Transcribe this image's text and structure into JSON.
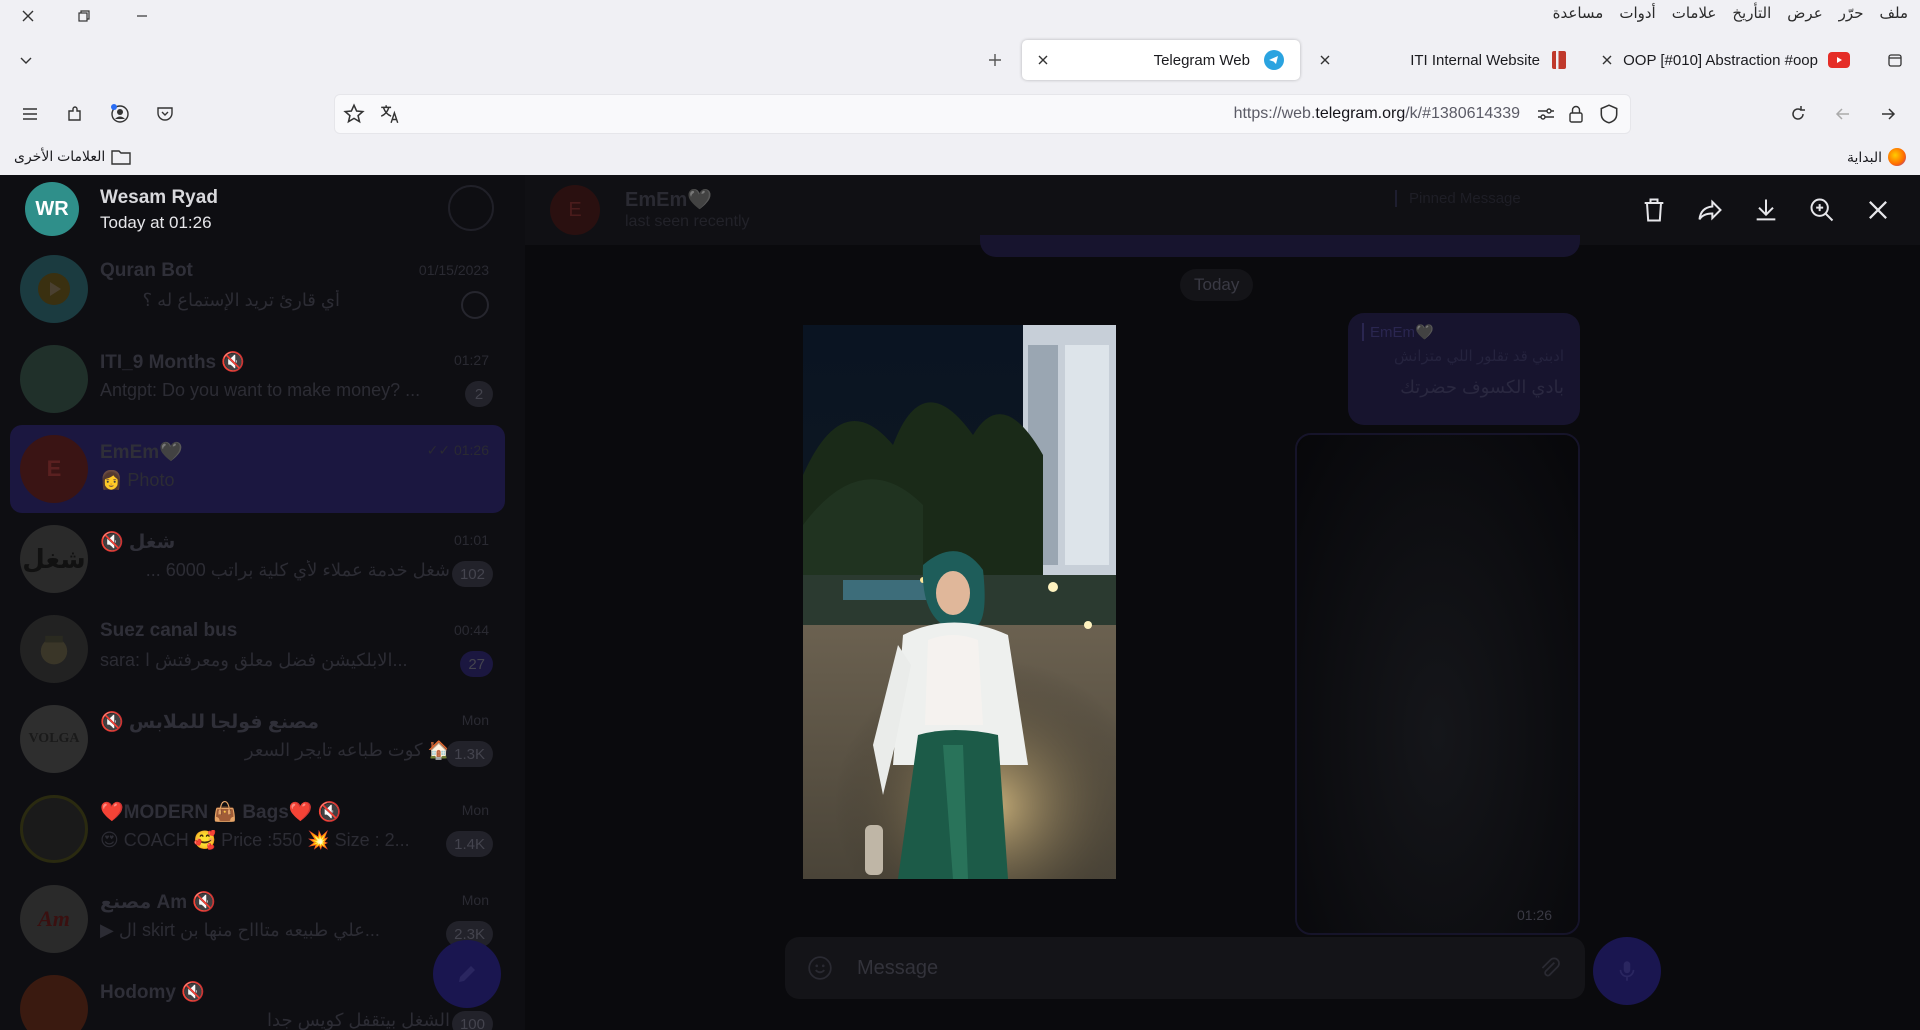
{
  "browser": {
    "menu": [
      "ملف",
      "حرّر",
      "عرض",
      "التأريخ",
      "علامات",
      "أدوات",
      "مساعدة"
    ],
    "tabs": [
      {
        "label": "OOP [#010] Abstraction #oop",
        "icon": "youtube-icon",
        "active": false
      },
      {
        "label": "ITI Internal Website",
        "icon": "iti-logo-icon",
        "active": false
      },
      {
        "label": "Telegram Web",
        "icon": "telegram-icon",
        "active": true
      }
    ],
    "url": {
      "prefix": "https://web.",
      "domain": "telegram.org",
      "suffix": "/k/#1380614339"
    },
    "bookmarks": {
      "home": "البداية",
      "other": "العلامات الأخرى"
    }
  },
  "viewer": {
    "author_initials": "WR",
    "author_name": "Wesam Ryad",
    "date": "Today at 01:26"
  },
  "chat_header": {
    "name": "EmEm🖤",
    "status": "last seen recently",
    "pinned": "Pinned Message"
  },
  "chats": [
    {
      "name": "Quran Bot",
      "preview": "أي قارئ تريد الإستماع له ؟",
      "time": "01/15/2023",
      "badge": "",
      "avatar_color": "#1b3b40"
    },
    {
      "name": "ITI_9 Months 🔇",
      "preview": "Antgpt: Do you want to make money? ...",
      "time": "01:27",
      "badge": "2",
      "avatar_color": "#20302a"
    },
    {
      "name": "EmEm🖤",
      "preview": "👩 Photo",
      "time": "✓✓ 01:26",
      "badge": "",
      "avatar_color": "#3a1414",
      "avatar_letter": "E"
    },
    {
      "name": "شغل 🔇",
      "preview": "شغل خدمة عملاء لأي كلية براتب 6000 ...",
      "time": "01:01",
      "badge": "102",
      "avatar_color": "#2a2a2a",
      "avatar_letter": "شغل"
    },
    {
      "name": "Suez canal bus",
      "preview": "sara: الابلكيشن فضل معلق ومعرفتش ا...",
      "time": "00:44",
      "badge": "27",
      "avatar_color": "#222",
      "avatar_letter": ""
    },
    {
      "name": "مصنع فولجا للملابس 🔇",
      "preview": "🏠 كوت طباعه تايجر السعر",
      "time": "Mon",
      "badge": "1.3K",
      "avatar_color": "#2e2e2e",
      "avatar_letter": "VOLGA"
    },
    {
      "name": "❤️MODERN 👜 Bags❤️ 🔇",
      "preview": "😍 COACH 🥰 Price :550 💥 Size : 2...",
      "time": "Mon",
      "badge": "1.4K",
      "avatar_color": "#1a1a1a",
      "avatar_letter": ""
    },
    {
      "name": "مصنع Am 🔇",
      "preview": "▶ ال skirt علي طبيعه متاااح منها بن...",
      "time": "Mon",
      "badge": "2.3K",
      "avatar_color": "#2a2a2a",
      "avatar_letter": "Am"
    },
    {
      "name": "Hodomy 🔇",
      "preview": "الشغل بيتقفل كويس جدا",
      "time": "",
      "badge": "100",
      "avatar_color": "#3a1a10",
      "avatar_letter": ""
    }
  ],
  "messages": {
    "today_chip": "Today",
    "reply_name": "EmEm🖤",
    "reply_text": "ادبني قد تقلور اللي متزانش",
    "message_text": "بادي الكسوف حضرتك",
    "photo_time": "01:26"
  },
  "composer": {
    "placeholder": "Message"
  }
}
